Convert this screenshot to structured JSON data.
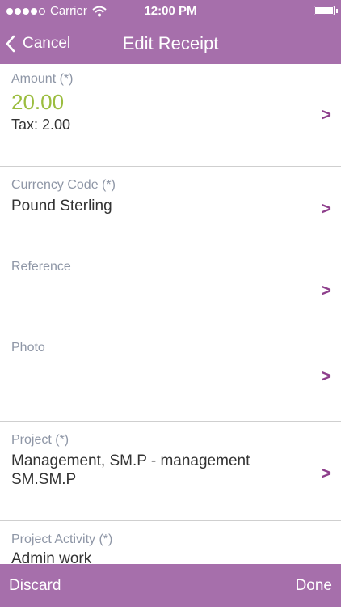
{
  "status_bar": {
    "carrier": "Carrier",
    "time": "12:00 PM",
    "signal_bars": 5,
    "signal_filled": 4
  },
  "nav": {
    "back_label": "Cancel",
    "title": "Edit Receipt"
  },
  "fields": {
    "amount": {
      "label": "Amount (*)",
      "value": "20.00",
      "tax": "Tax: 2.00"
    },
    "currency": {
      "label": "Currency Code (*)",
      "value": "Pound Sterling"
    },
    "reference": {
      "label": "Reference",
      "value": ""
    },
    "photo": {
      "label": "Photo",
      "value": ""
    },
    "project": {
      "label": "Project (*)",
      "value_line1": "Management, SM.P - management",
      "value_line2": "SM.SM.P"
    },
    "project_activity": {
      "label": "Project Activity (*)",
      "value": "Admin work"
    }
  },
  "chevron": ">",
  "toolbar": {
    "discard_label": "Discard",
    "done_label": "Done"
  },
  "colors": {
    "accent": "#a66fab",
    "chevron": "#8e3f8c",
    "amount_value": "#9bbd3f",
    "label": "#8e96a6"
  }
}
